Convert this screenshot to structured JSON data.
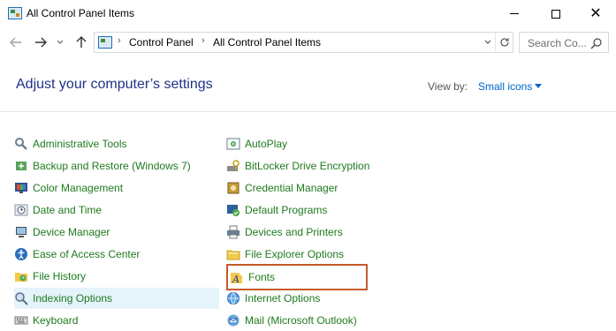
{
  "window": {
    "title": "All Control Panel Items"
  },
  "nav": {
    "breadcrumbs": [
      "Control Panel",
      "All Control Panel Items"
    ],
    "search_placeholder": "Search Co..."
  },
  "header": {
    "heading": "Adjust your computer’s settings",
    "view_by_label": "View by:",
    "view_by_value": "Small icons"
  },
  "items": {
    "col1": [
      {
        "label": "Administrative Tools",
        "icon": "admin-tools-icon"
      },
      {
        "label": "Backup and Restore (Windows 7)",
        "icon": "backup-icon"
      },
      {
        "label": "Color Management",
        "icon": "color-management-icon"
      },
      {
        "label": "Date and Time",
        "icon": "clock-icon"
      },
      {
        "label": "Device Manager",
        "icon": "device-manager-icon"
      },
      {
        "label": "Ease of Access Center",
        "icon": "ease-of-access-icon"
      },
      {
        "label": "File History",
        "icon": "file-history-icon"
      },
      {
        "label": "Indexing Options",
        "icon": "indexing-icon"
      },
      {
        "label": "Keyboard",
        "icon": "keyboard-icon"
      }
    ],
    "col2": [
      {
        "label": "AutoPlay",
        "icon": "autoplay-icon"
      },
      {
        "label": "BitLocker Drive Encryption",
        "icon": "bitlocker-icon"
      },
      {
        "label": "Credential Manager",
        "icon": "credential-icon"
      },
      {
        "label": "Default Programs",
        "icon": "default-programs-icon"
      },
      {
        "label": "Devices and Printers",
        "icon": "printer-icon"
      },
      {
        "label": "File Explorer Options",
        "icon": "folder-options-icon"
      },
      {
        "label": "Fonts",
        "icon": "fonts-icon"
      },
      {
        "label": "Internet Options",
        "icon": "internet-icon"
      },
      {
        "label": "Mail (Microsoft Outlook)",
        "icon": "mail-icon"
      }
    ]
  },
  "colors": {
    "link_green": "#1d7a1d",
    "heading_blue": "#1e3287",
    "accent_blue": "#0066cc",
    "hover_bg": "#e5f3fb",
    "highlight_border": "#c65a2a"
  }
}
